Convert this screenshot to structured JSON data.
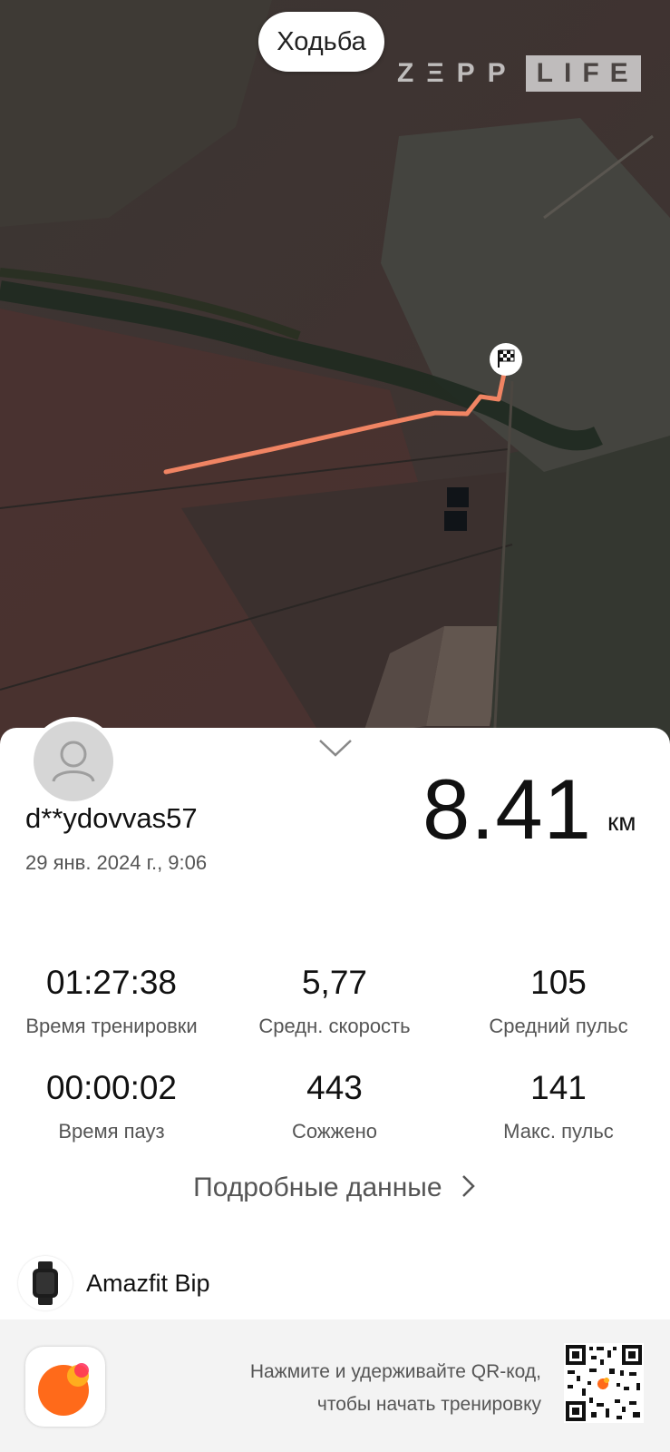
{
  "map": {
    "activity_type": "Ходьба",
    "brand_part1": "ZΞPP",
    "brand_part2": "LIFE",
    "route_color": "#f08463",
    "finish_icon": "checkered-flag-icon"
  },
  "summary": {
    "username": "d**ydovvas57",
    "datetime": "29 янв. 2024 г., 9:06",
    "distance": "8.41",
    "distance_unit": "км",
    "collapse_icon": "chevron-down-icon"
  },
  "stats": [
    {
      "value": "01:27:38",
      "label": "Время тренировки"
    },
    {
      "value": "5,77",
      "label": "Средн. скорость"
    },
    {
      "value": "105",
      "label": "Средний пульс"
    },
    {
      "value": "00:00:02",
      "label": "Время пауз"
    },
    {
      "value": "443",
      "label": "Сожжено"
    },
    {
      "value": "141",
      "label": "Макс. пульс"
    }
  ],
  "details_link": "Подробные данные",
  "device": {
    "name": "Amazfit Bip",
    "icon": "smartwatch-icon"
  },
  "footer": {
    "line1": "Нажмите и удерживайте QR-код,",
    "line2": "чтобы начать тренировку",
    "app_icon": "zepp-life-app-icon",
    "qr_icon": "qr-code-icon"
  }
}
